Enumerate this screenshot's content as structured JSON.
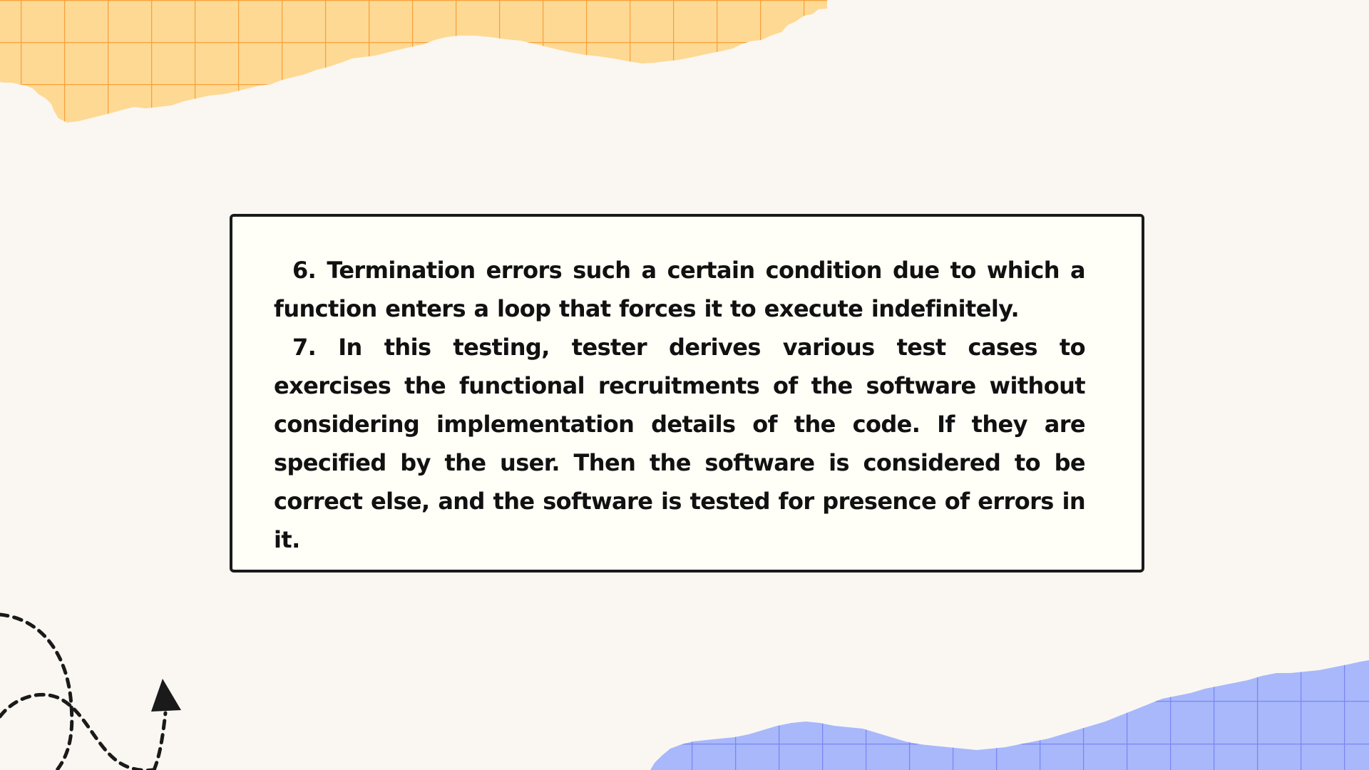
{
  "slide": {
    "items": [
      {
        "number": "6.",
        "text": "Termination errors such a certain condition due to which a function enters a loop that forces it to execute indefinitely."
      },
      {
        "number": "7.",
        "text": "In this testing, tester derives various test cases to exercises the functional recruitments of the software without considering implementation details of the code. If they are specified by the user. Then the software is considered to be correct else, and the software is tested for presence of errors in it."
      }
    ]
  },
  "colors": {
    "background": "#faf7f2",
    "card_background": "#fffef7",
    "card_border": "#1a1a1a",
    "text": "#111111",
    "orange_paper": "#fed994",
    "orange_grid": "#f6a13c",
    "blue_paper": "#a8b8fb",
    "blue_grid": "#7a86f2",
    "doodle": "#1a1a1a"
  },
  "decorations": [
    "torn-orange-grid-paper",
    "torn-blue-grid-paper",
    "dashed-arrow-doodle"
  ]
}
